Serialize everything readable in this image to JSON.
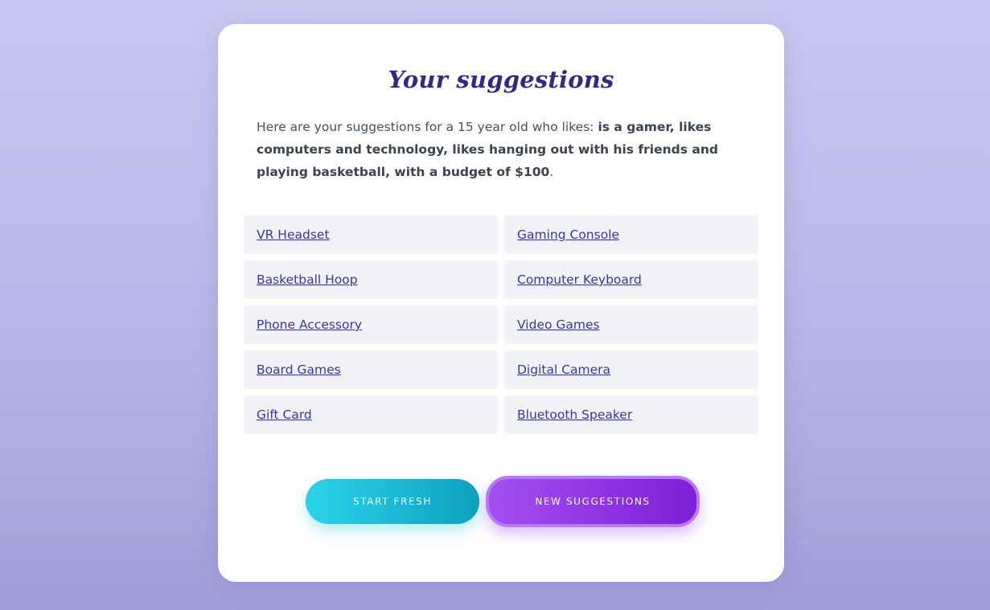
{
  "page": {
    "title": "Your suggestions"
  },
  "intro": {
    "prefix": "Here are your suggestions for a 15 year old who likes: ",
    "likes": "is a gamer, likes computers and technology, likes hanging out with his friends and playing basketball, with a budget of $100",
    "suffix": "."
  },
  "suggestions": [
    "VR Headset",
    "Gaming Console",
    "Basketball Hoop",
    "Computer Keyboard",
    "Phone Accessory",
    "Video Games",
    "Board Games",
    "Digital Camera",
    "Gift Card",
    "Bluetooth Speaker"
  ],
  "actions": {
    "start_fresh": "START FRESH",
    "new_suggestions": "NEW SUGGESTIONS"
  },
  "colors": {
    "title": "#2e2a86",
    "link": "#3b35a8",
    "start_fresh_gradient": [
      "#2bd3ea",
      "#0ea0c0"
    ],
    "new_suggestions_gradient": [
      "#a34ff0",
      "#7d1fd6"
    ]
  }
}
